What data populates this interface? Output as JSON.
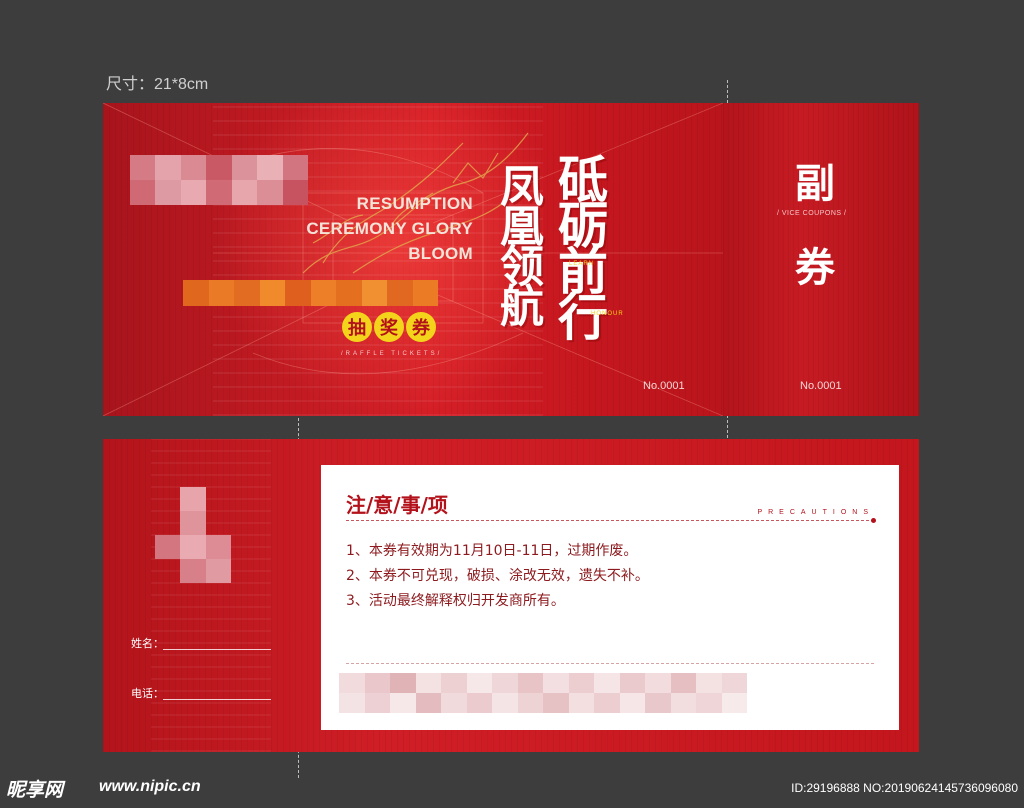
{
  "size_label": "尺寸：21*8cm",
  "front": {
    "english_title": [
      "RESUMPTION",
      "CEREMONY GLORY",
      "BLOOM"
    ],
    "calligraphy_left": "凤凰领航",
    "calligraphy_right": "砥砺前行",
    "raffle_chars": [
      "抽",
      "奖",
      "券"
    ],
    "raffle_sub": "/RAFFLE TICKETS/",
    "tiny_learn": "LEARN",
    "tiny_honour": "HONOUR",
    "number": "No.0001",
    "stub": {
      "char_top": "副",
      "char_bottom": "券",
      "sub": "/ VICE COUPONS /",
      "number": "No.0001"
    }
  },
  "back": {
    "name_label": "姓名：",
    "phone_label": "电话：",
    "notice_title": "注/意/事/项",
    "notice_en": "PRECAUTIONS",
    "notice_items": [
      "1、本券有效期为11月10日-11日，过期作废。",
      "2、本券不可兑现，破损、涂改无效，遗失不补。",
      "3、活动最终解释权归开发商所有。"
    ]
  },
  "watermark": {
    "logo": "昵享网",
    "url": "www.nipic.cn",
    "id": "ID:29196888 NO:20190624145736096080"
  },
  "colors": {
    "background": "#3d3d3d",
    "ticket_red": "#c5161e",
    "accent_yellow": "#f3d41a",
    "notice_red": "#b3121b"
  }
}
